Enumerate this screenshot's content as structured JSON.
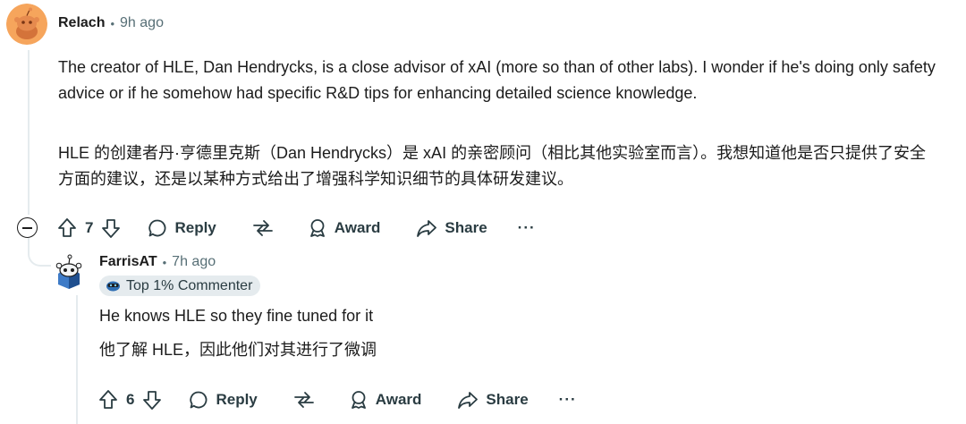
{
  "comment": {
    "author": "Relach",
    "time": "9h ago",
    "body_en": "The creator of HLE, Dan Hendrycks, is a close advisor of xAI (more so than of other labs). I wonder if he's doing only safety advice or if he somehow had specific R&D tips for enhancing detailed science knowledge.",
    "body_zh": "HLE 的创建者丹·亨德里克斯（Dan Hendrycks）是 xAI 的亲密顾问（相比其他实验室而言）。我想知道他是否只提供了安全方面的建议，还是以某种方式给出了增强科学知识细节的具体研发建议。",
    "votes": "7",
    "reply_label": "Reply",
    "award_label": "Award",
    "share_label": "Share",
    "more_label": "···"
  },
  "reply": {
    "author": "FarrisAT",
    "time": "7h ago",
    "badge": "Top 1% Commenter",
    "body_en": "He knows HLE so they fine tuned for it",
    "body_zh": "他了解 HLE，因此他们对其进行了微调",
    "votes": "6",
    "reply_label": "Reply",
    "award_label": "Award",
    "share_label": "Share",
    "more_label": "···"
  },
  "separator": "•",
  "colors": {
    "text": "#1c1c1c",
    "muted": "#576f76",
    "thread_line": "#e5ebee",
    "badge_bg": "#e5ebee",
    "avatar_orange": "#f6a55c"
  },
  "icons": [
    "snoo-avatar-icon",
    "robot-avatar-icon",
    "minus-circle-icon",
    "upvote-icon",
    "downvote-icon",
    "comment-bubble-icon",
    "share-arrow-icon",
    "award-icon",
    "share-icon",
    "more-icon",
    "commenter-badge-icon"
  ]
}
